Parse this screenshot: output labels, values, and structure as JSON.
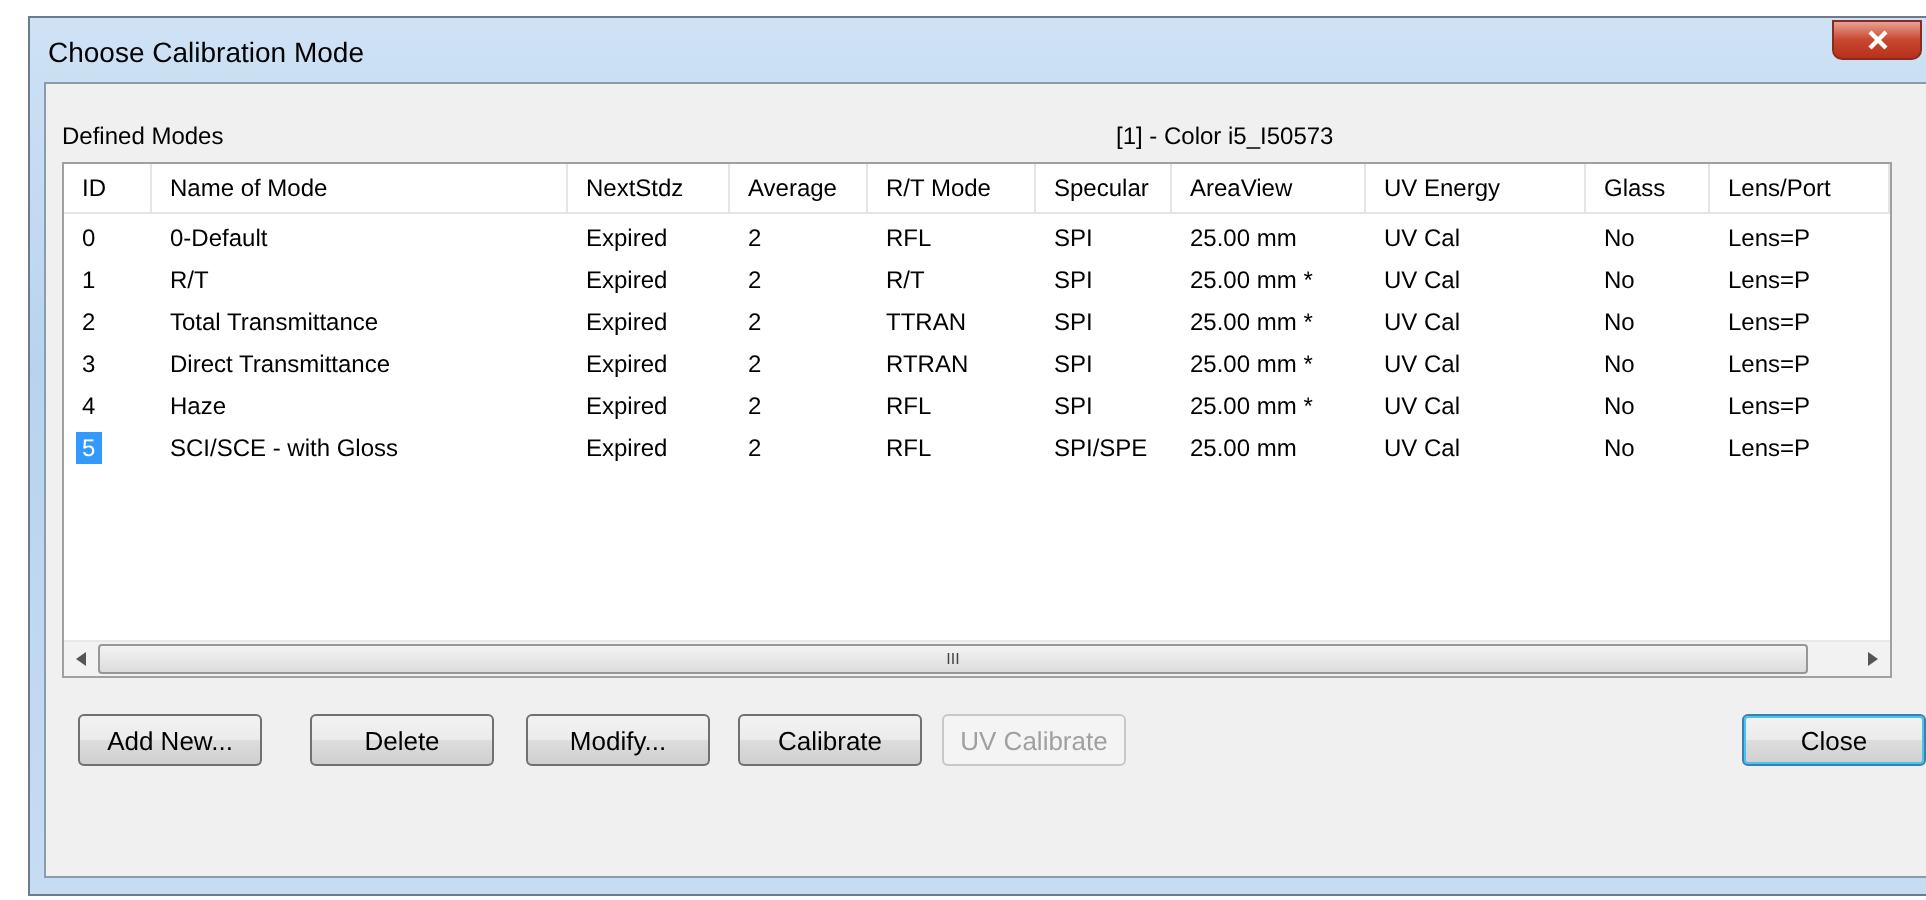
{
  "window": {
    "title": "Choose Calibration Mode"
  },
  "group": {
    "label": "Defined Modes",
    "instrument": "[1] - Color i5_I50573"
  },
  "table": {
    "columns": [
      "ID",
      "Name of Mode",
      "NextStdz",
      "Average",
      "R/T Mode",
      "Specular",
      "AreaView",
      "UV Energy",
      "Glass",
      "Lens/Port"
    ],
    "rows": [
      {
        "selected": false,
        "cells": [
          "0",
          "0-Default",
          "Expired",
          "2",
          "RFL",
          "SPI",
          "25.00 mm",
          "UV Cal",
          "No",
          "Lens=P"
        ]
      },
      {
        "selected": false,
        "cells": [
          "1",
          "R/T",
          "Expired",
          "2",
          "R/T",
          "SPI",
          "25.00 mm *",
          "UV Cal",
          "No",
          "Lens=P"
        ]
      },
      {
        "selected": false,
        "cells": [
          "2",
          "Total Transmittance",
          "Expired",
          "2",
          "TTRAN",
          "SPI",
          "25.00 mm *",
          "UV Cal",
          "No",
          "Lens=P"
        ]
      },
      {
        "selected": false,
        "cells": [
          "3",
          "Direct Transmittance",
          "Expired",
          "2",
          "RTRAN",
          "SPI",
          "25.00 mm *",
          "UV Cal",
          "No",
          "Lens=P"
        ]
      },
      {
        "selected": false,
        "cells": [
          "4",
          "Haze",
          "Expired",
          "2",
          "RFL",
          "SPI",
          "25.00 mm *",
          "UV Cal",
          "No",
          "Lens=P"
        ]
      },
      {
        "selected": true,
        "cells": [
          "5",
          "SCI/SCE - with Gloss",
          "Expired",
          "2",
          "RFL",
          "SPI/SPE",
          "25.00 mm",
          "UV Cal",
          "No",
          "Lens=P"
        ]
      }
    ],
    "scrollbar_grip": "III"
  },
  "buttons": [
    {
      "label": "Add New...",
      "disabled": false,
      "default": false
    },
    {
      "label": "Delete",
      "disabled": false,
      "default": false
    },
    {
      "label": "Modify...",
      "disabled": false,
      "default": false
    },
    {
      "label": "Calibrate",
      "disabled": false,
      "default": false
    },
    {
      "label": "UV Calibrate",
      "disabled": true,
      "default": false
    },
    {
      "label": "Close",
      "disabled": false,
      "default": true
    }
  ]
}
